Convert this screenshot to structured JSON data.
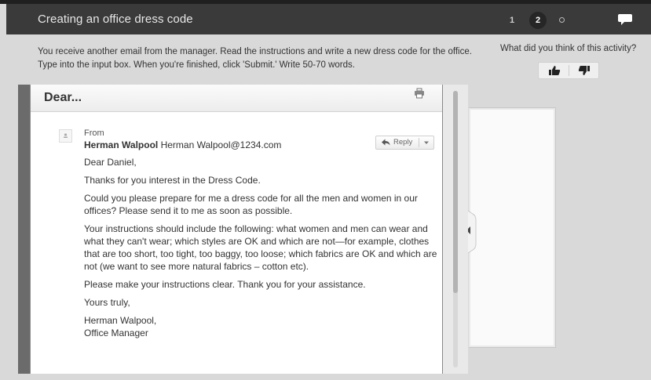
{
  "header": {
    "title": "Creating an office dress code",
    "steps": [
      "1",
      "2"
    ]
  },
  "instructions": "You receive another email from the manager. Read the instructions and write a new dress code for the office. Type into the input box. When you're finished, click 'Submit.' Write 50-70 words.",
  "feedback": {
    "label": "What did you think of this activity?"
  },
  "email": {
    "subject": "Dear...",
    "from_label": "From",
    "sender_name": "Herman Walpool",
    "sender_address": "Herman Walpool@1234.com",
    "reply_label": "Reply",
    "greeting": "Dear Daniel,",
    "paragraphs": [
      "Thanks for you interest in the Dress Code.",
      "Could you please prepare for me a dress code for all the men and women in our offices? Please send it to me as soon as possible.",
      "Your instructions should include the following: what women and men can wear and what they can't wear; which styles are OK and which are not—for example, clothes that are too short, too tight, too baggy, too loose; which fabrics are OK and which are not (we want to see more natural fabrics – cotton etc).",
      "Please make your instructions clear. Thank you for your assistance.",
      "Yours truly,"
    ],
    "signature_name": "Herman Walpool,",
    "signature_title": "Office Manager"
  },
  "colors": {
    "header_bg": "#3a3a3a",
    "page_bg": "#d9d9d9",
    "active_step": "#262626"
  }
}
